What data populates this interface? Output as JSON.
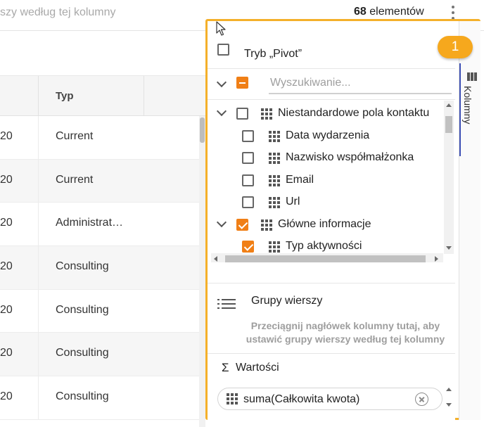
{
  "header": {
    "drop_hint": "szy według tej kolumny",
    "item_count": "68",
    "item_count_suffix": " elementów"
  },
  "grid": {
    "column_header": "Typ",
    "rows": [
      {
        "c1": "20",
        "c2": "Current"
      },
      {
        "c1": "20",
        "c2": "Current"
      },
      {
        "c1": "20",
        "c2": "Administrat…"
      },
      {
        "c1": "20",
        "c2": "Consulting"
      },
      {
        "c1": "20",
        "c2": "Consulting"
      },
      {
        "c1": "20",
        "c2": "Consulting"
      },
      {
        "c1": "20",
        "c2": "Consulting"
      }
    ]
  },
  "panel": {
    "pivot_label": "Tryb „Pivot”",
    "search_placeholder": "Wyszukiwanie...",
    "side_tab_label": "Kolumny",
    "tree": [
      {
        "label": "Niestandardowe pola kontaktu",
        "level": 0,
        "expandable": true,
        "state": "unchecked"
      },
      {
        "label": "Data wydarzenia",
        "level": 1,
        "expandable": false,
        "state": "unchecked"
      },
      {
        "label": "Nazwisko współmałżonka",
        "level": 1,
        "expandable": false,
        "state": "unchecked"
      },
      {
        "label": "Email",
        "level": 1,
        "expandable": false,
        "state": "unchecked"
      },
      {
        "label": "Url",
        "level": 1,
        "expandable": false,
        "state": "unchecked"
      },
      {
        "label": "Główne informacje",
        "level": 0,
        "expandable": true,
        "state": "checked"
      },
      {
        "label": "Typ aktywności",
        "level": 1,
        "expandable": false,
        "state": "checked"
      }
    ],
    "row_groups_title": "Grupy wierszy",
    "row_groups_hint": "Przeciągnij nagłówek kolumny tutaj, aby ustawić grupy wierszy według tej kolumny",
    "values_sigma": "Σ",
    "values_title": "Wartości",
    "value_chip": "suma(Całkowita kwota)"
  },
  "callout": {
    "number": "1"
  },
  "colors": {
    "accent": "#f07f16",
    "highlight_border": "#f4b02a",
    "badge": "#f6a81d",
    "tab_indicator": "#3f51b5"
  }
}
